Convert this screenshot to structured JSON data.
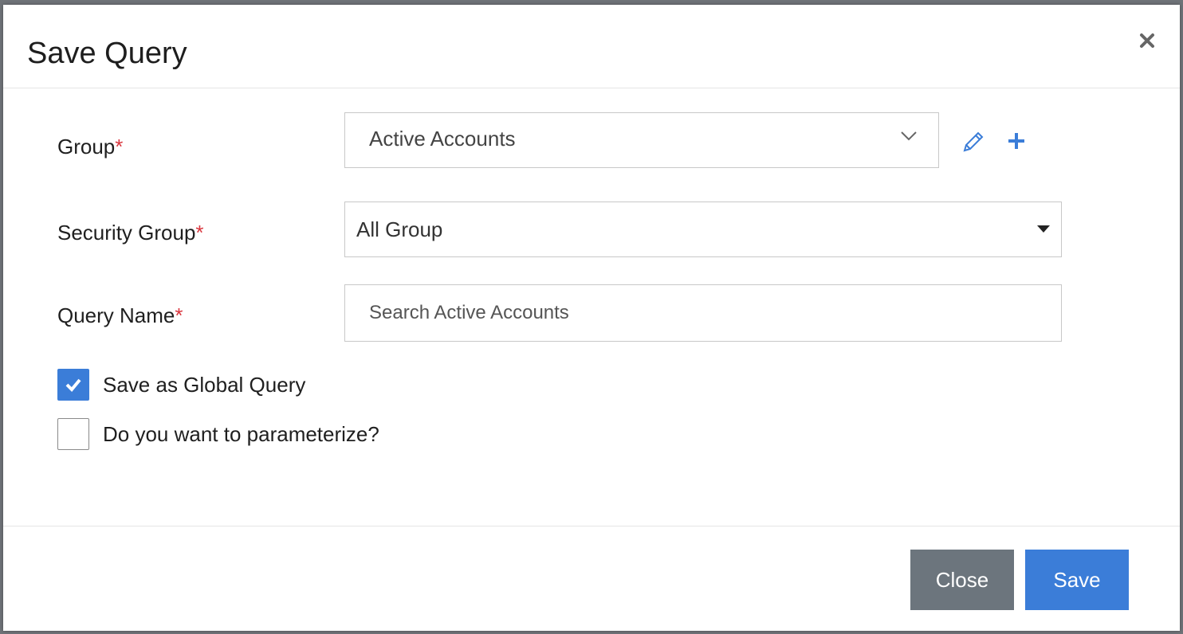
{
  "modal": {
    "title": "Save Query",
    "close_icon": "close-icon"
  },
  "form": {
    "group": {
      "label": "Group",
      "required_marker": "*",
      "selected": "Active Accounts",
      "edit_icon": "pencil-icon",
      "add_icon": "plus-icon"
    },
    "security_group": {
      "label": "Security Group",
      "required_marker": "*",
      "selected": "All Group"
    },
    "query_name": {
      "label": "Query Name",
      "required_marker": "*",
      "value": "",
      "placeholder": "Search Active Accounts"
    },
    "save_global": {
      "label": "Save as Global Query",
      "checked": true
    },
    "parameterize": {
      "label": "Do you want to parameterize?",
      "checked": false
    }
  },
  "footer": {
    "close_label": "Close",
    "save_label": "Save"
  },
  "colors": {
    "primary": "#3b7dd8",
    "secondary": "#6c757d",
    "required": "#d9363e"
  }
}
